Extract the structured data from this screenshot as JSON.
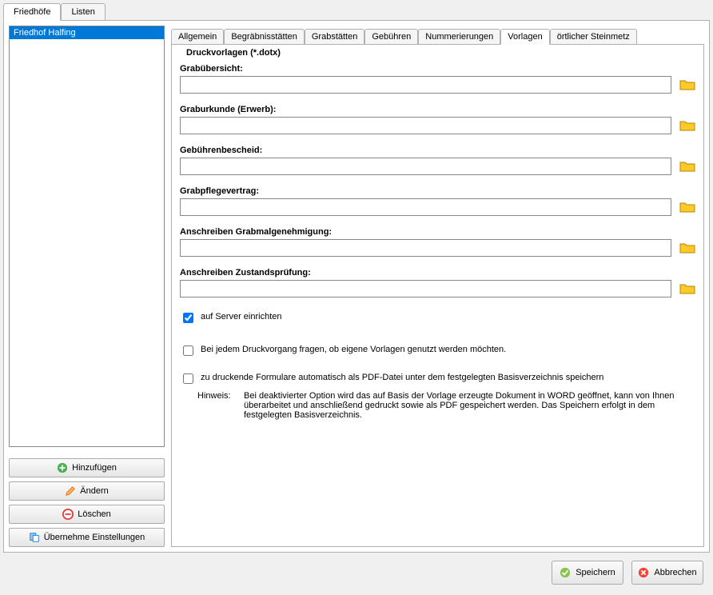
{
  "outerTabs": {
    "t0": "Friedhöfe",
    "t1": "Listen"
  },
  "list": {
    "item0": "Friedhof Halfing"
  },
  "sideButtons": {
    "add": "Hinzufügen",
    "edit": "Ändern",
    "delete": "Löschen",
    "adopt": "Übernehme Einstellungen"
  },
  "innerTabs": {
    "t0": "Allgemein",
    "t1": "Begräbnisstätten",
    "t2": "Grabstätten",
    "t3": "Gebühren",
    "t4": "Nummerierungen",
    "t5": "Vorlagen",
    "t6": "örtlicher Steinmetz"
  },
  "group": {
    "heading": "Druckvorlagen (*.dotx)"
  },
  "fields": {
    "f1": {
      "label": "Grabübersicht:",
      "value": ""
    },
    "f2": {
      "label": "Graburkunde (Erwerb):",
      "value": ""
    },
    "f3": {
      "label": "Gebührenbescheid:",
      "value": ""
    },
    "f4": {
      "label": "Grabpflegevertrag:",
      "value": ""
    },
    "f5": {
      "label": "Anschreiben Grabmalgenehmigung:",
      "value": ""
    },
    "f6": {
      "label": "Anschreiben Zustandsprüfung:",
      "value": ""
    }
  },
  "checkboxes": {
    "c1": "auf Server einrichten",
    "c2": "Bei jedem Druckvorgang fragen, ob eigene Vorlagen genutzt werden möchten.",
    "c3": "zu druckende Formulare automatisch als PDF-Datei unter dem festgelegten Basisverzeichnis speichern"
  },
  "hinweis": {
    "label": "Hinweis:",
    "text": "Bei deaktivierter Option wird das auf Basis der Vorlage erzeugte Dokument in WORD geöffnet, kann von Ihnen überarbeitet und anschließend gedruckt sowie als PDF gespeichert werden. Das Speichern erfolgt in dem festgelegten Basisverzeichnis."
  },
  "actions": {
    "save": "Speichern",
    "cancel": "Abbrechen"
  }
}
